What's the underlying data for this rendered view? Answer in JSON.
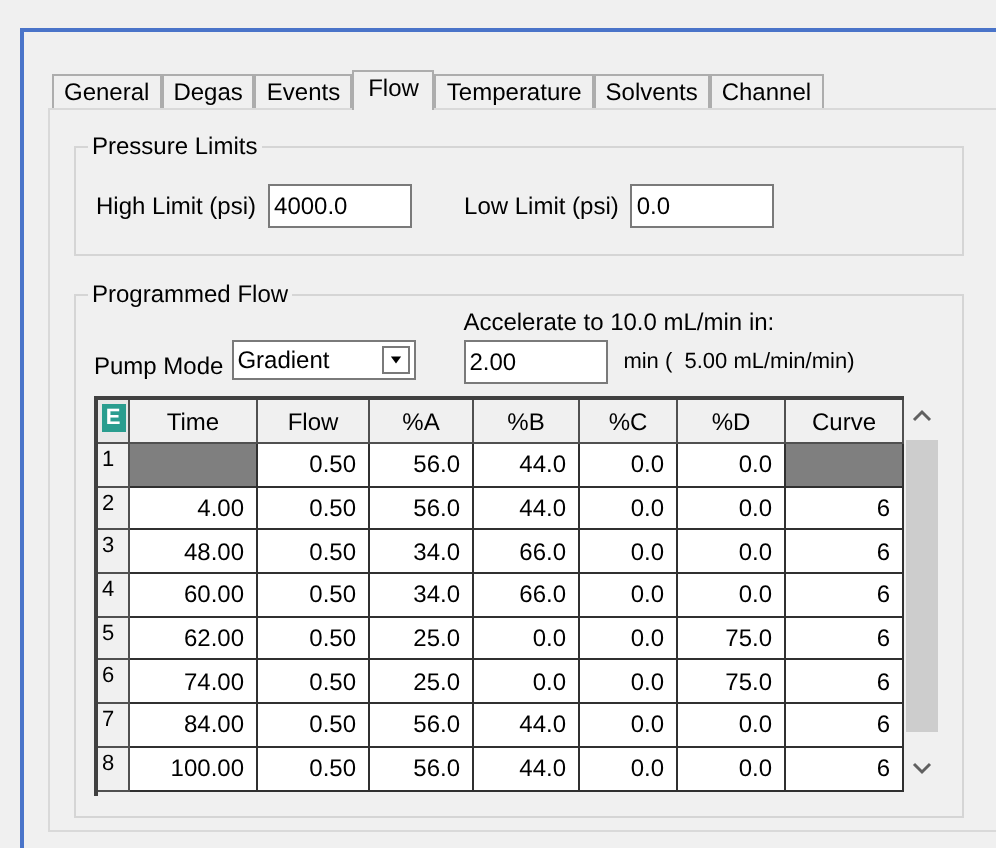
{
  "tabs": [
    {
      "label": "General",
      "selected": false
    },
    {
      "label": "Degas",
      "selected": false
    },
    {
      "label": "Events",
      "selected": false
    },
    {
      "label": "Flow",
      "selected": true
    },
    {
      "label": "Temperature",
      "selected": false
    },
    {
      "label": "Solvents",
      "selected": false
    },
    {
      "label": "Channel",
      "selected": false
    }
  ],
  "pressure_limits": {
    "title": "Pressure Limits",
    "high_label": "High Limit (psi)",
    "high_value": "4000.0",
    "low_label": "Low Limit (psi)",
    "low_value": "0.0"
  },
  "programmed_flow": {
    "title": "Programmed Flow",
    "pump_mode_label": "Pump Mode",
    "pump_mode_value": "Gradient",
    "accelerate_label": "Accelerate to 10.0 mL/min in:",
    "accelerate_value": "2.00",
    "accelerate_unit": "min (  5.00 mL/min/min)"
  },
  "table": {
    "corner_label": "E",
    "columns": [
      "Time",
      "Flow",
      "%A",
      "%B",
      "%C",
      "%D",
      "Curve"
    ],
    "rows": [
      {
        "number": "1",
        "cells": [
          null,
          "0.50",
          "56.0",
          "44.0",
          "0.0",
          "0.0",
          null
        ]
      },
      {
        "number": "2",
        "cells": [
          "4.00",
          "0.50",
          "56.0",
          "44.0",
          "0.0",
          "0.0",
          "6"
        ]
      },
      {
        "number": "3",
        "cells": [
          "48.00",
          "0.50",
          "34.0",
          "66.0",
          "0.0",
          "0.0",
          "6"
        ]
      },
      {
        "number": "4",
        "cells": [
          "60.00",
          "0.50",
          "34.0",
          "66.0",
          "0.0",
          "0.0",
          "6"
        ]
      },
      {
        "number": "5",
        "cells": [
          "62.00",
          "0.50",
          "25.0",
          "0.0",
          "0.0",
          "75.0",
          "6"
        ]
      },
      {
        "number": "6",
        "cells": [
          "74.00",
          "0.50",
          "25.0",
          "0.0",
          "0.0",
          "75.0",
          "6"
        ]
      },
      {
        "number": "7",
        "cells": [
          "84.00",
          "0.50",
          "56.0",
          "44.0",
          "0.0",
          "0.0",
          "6"
        ]
      },
      {
        "number": "8",
        "cells": [
          "100.00",
          "0.50",
          "56.0",
          "44.0",
          "0.0",
          "0.0",
          "6"
        ]
      }
    ]
  }
}
